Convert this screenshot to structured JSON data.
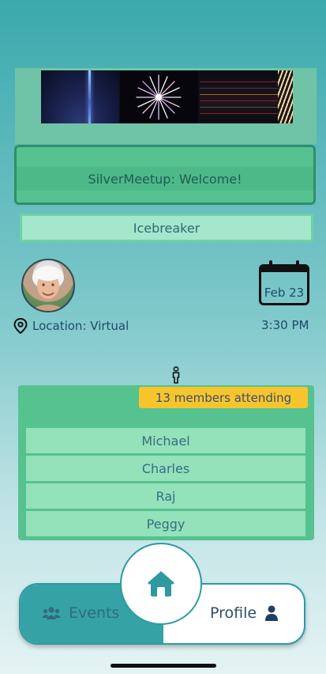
{
  "event": {
    "title": "SilverMeetup: Welcome!",
    "category": "Icebreaker",
    "location_label": "Location: Virtual",
    "date": "Feb 23",
    "time": "3:30 PM",
    "attending_badge": "13 members attending"
  },
  "members": [
    "Michael",
    "Charles",
    "Raj",
    "Peggy"
  ],
  "nav": {
    "events_label": "Events",
    "profile_label": "Profile"
  },
  "icons": {
    "location": "map-pin-icon",
    "calendar": "calendar-icon",
    "person": "person-icon",
    "events": "users-icon",
    "profile": "user-icon",
    "home": "home-icon"
  },
  "colors": {
    "accent": "#35a3a5",
    "panel_green": "#55c28f",
    "badge_yellow": "#f7c52b"
  }
}
